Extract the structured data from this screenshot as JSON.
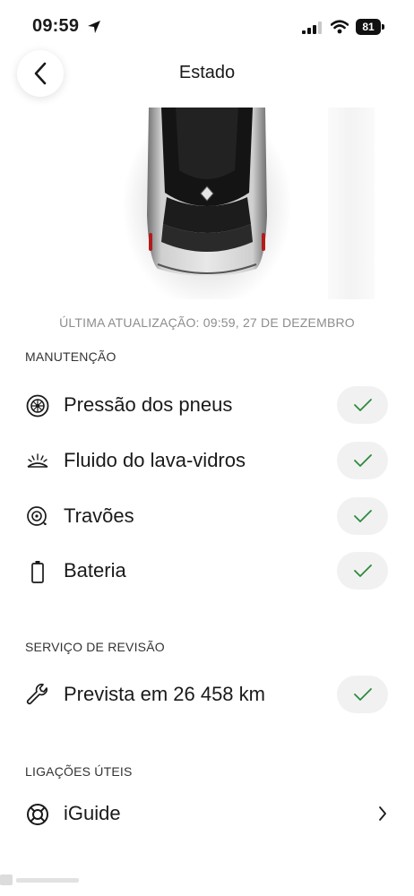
{
  "status_bar": {
    "time": "09:59",
    "battery": "81"
  },
  "header": {
    "title": "Estado"
  },
  "last_update": "ÚLTIMA ATUALIZAÇÃO: 09:59, 27 DE DEZEMBRO",
  "maintenance": {
    "title": "MANUTENÇÃO",
    "items": [
      {
        "label": "Pressão dos pneus",
        "icon": "tire-icon",
        "status": "ok"
      },
      {
        "label": "Fluido do lava-vidros",
        "icon": "washer-fluid-icon",
        "status": "ok"
      },
      {
        "label": "Travões",
        "icon": "brake-icon",
        "status": "ok"
      },
      {
        "label": "Bateria",
        "icon": "battery-icon",
        "status": "ok"
      }
    ]
  },
  "service": {
    "title": "SERVIÇO DE REVISÃO",
    "items": [
      {
        "label": "Prevista em 26 458 km",
        "icon": "wrench-icon",
        "status": "ok"
      }
    ]
  },
  "links": {
    "title": "LIGAÇÕES ÚTEIS",
    "items": [
      {
        "label": "iGuide",
        "icon": "lifebuoy-icon"
      }
    ]
  },
  "colors": {
    "check": "#2e8b3e",
    "pill": "#f1f1f1",
    "muted": "#8d8d8d"
  }
}
